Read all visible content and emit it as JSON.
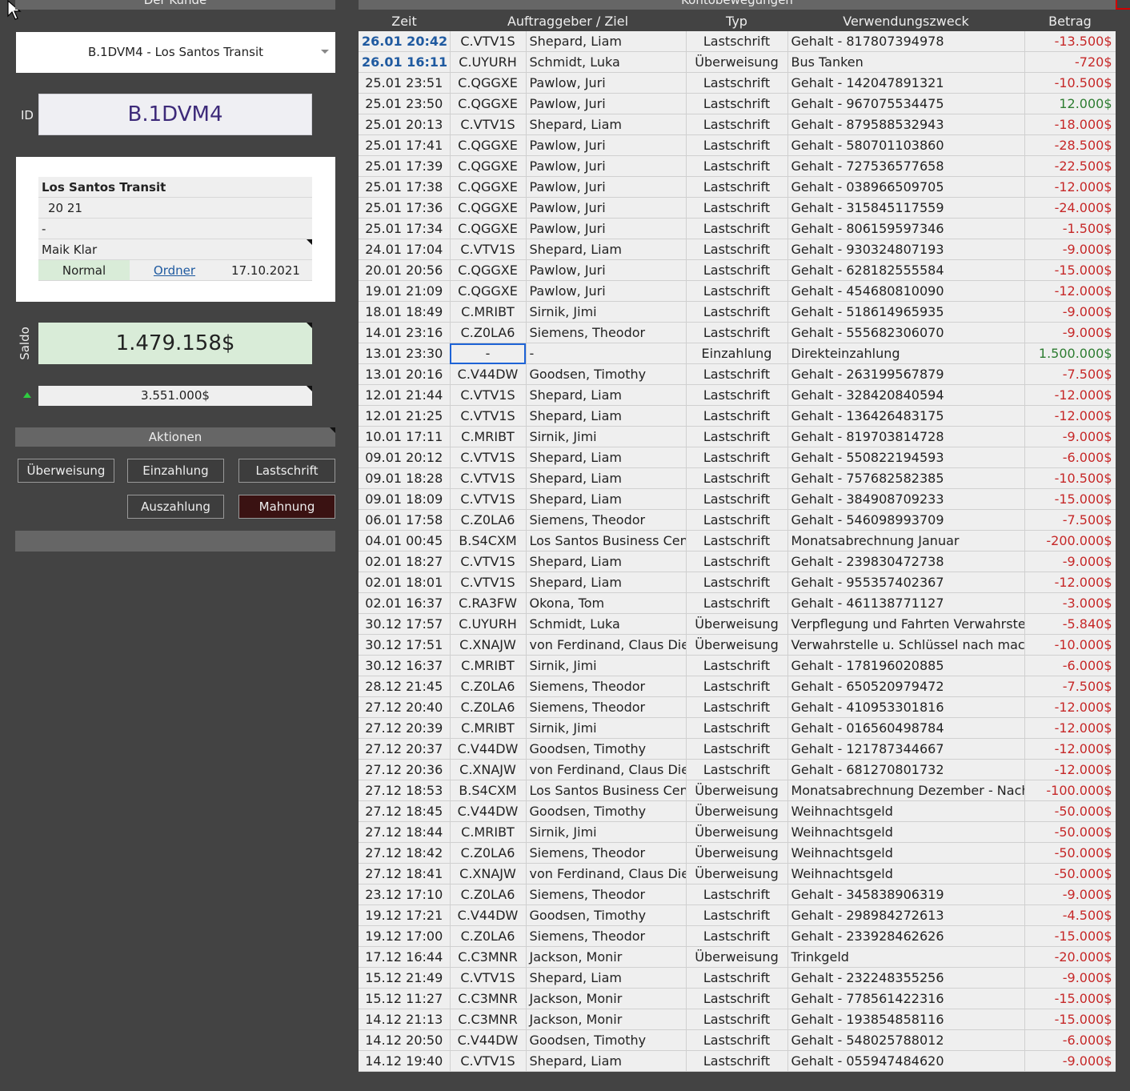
{
  "left": {
    "header": "Der Kunde",
    "customer_select": "B.1DVM4 - Los Santos Transit",
    "id_label": "ID",
    "id_value": "B.1DVM4",
    "info": {
      "name": "Los Santos Transit",
      "line2": "20 21",
      "line3": "-",
      "contact": "Maik Klar",
      "status": "Normal",
      "folder_link": "Ordner",
      "date": "17.10.2021"
    },
    "saldo_label": "Saldo",
    "saldo_value": "1.479.158$",
    "sub_value": "3.551.000$",
    "actions_header": "Aktionen",
    "buttons": {
      "ueberweisung": "Überweisung",
      "einzahlung": "Einzahlung",
      "lastschrift": "Lastschrift",
      "auszahlung": "Auszahlung",
      "mahnung": "Mahnung"
    }
  },
  "right": {
    "header": "Kontobewegungen",
    "columns": [
      "Zeit",
      "Auftraggeber / Ziel",
      "Typ",
      "Verwendungszweck",
      "Betrag"
    ],
    "rows": [
      [
        "26.01 20:42",
        "C.VTV1S",
        "Shepard, Liam",
        "Lastschrift",
        "Gehalt - 817807394978",
        "-13.500$"
      ],
      [
        "26.01 16:11",
        "C.UYURH",
        "Schmidt, Luka",
        "Überweisung",
        "Bus Tanken",
        "-720$"
      ],
      [
        "25.01 23:51",
        "C.QGGXE",
        "Pawlow, Juri",
        "Lastschrift",
        "Gehalt - 142047891321",
        "-10.500$"
      ],
      [
        "25.01 23:50",
        "C.QGGXE",
        "Pawlow, Juri",
        "Lastschrift",
        "Gehalt - 967075534475",
        "12.000$"
      ],
      [
        "25.01 20:13",
        "C.VTV1S",
        "Shepard, Liam",
        "Lastschrift",
        "Gehalt - 879588532943",
        "-18.000$"
      ],
      [
        "25.01 17:41",
        "C.QGGXE",
        "Pawlow, Juri",
        "Lastschrift",
        "Gehalt - 580701103860",
        "-28.500$"
      ],
      [
        "25.01 17:39",
        "C.QGGXE",
        "Pawlow, Juri",
        "Lastschrift",
        "Gehalt - 727536577658",
        "-22.500$"
      ],
      [
        "25.01 17:38",
        "C.QGGXE",
        "Pawlow, Juri",
        "Lastschrift",
        "Gehalt - 038966509705",
        "-12.000$"
      ],
      [
        "25.01 17:36",
        "C.QGGXE",
        "Pawlow, Juri",
        "Lastschrift",
        "Gehalt - 315845117559",
        "-24.000$"
      ],
      [
        "25.01 17:34",
        "C.QGGXE",
        "Pawlow, Juri",
        "Lastschrift",
        "Gehalt - 806159597346",
        "-1.500$"
      ],
      [
        "24.01 17:04",
        "C.VTV1S",
        "Shepard, Liam",
        "Lastschrift",
        "Gehalt - 930324807193",
        "-9.000$"
      ],
      [
        "20.01 20:56",
        "C.QGGXE",
        "Pawlow, Juri",
        "Lastschrift",
        "Gehalt - 628182555584",
        "-15.000$"
      ],
      [
        "19.01 21:09",
        "C.QGGXE",
        "Pawlow, Juri",
        "Lastschrift",
        "Gehalt - 454680810090",
        "-12.000$"
      ],
      [
        "18.01 18:49",
        "C.MRIBT",
        "Sirnik, Jimi",
        "Lastschrift",
        "Gehalt - 518614965935",
        "-9.000$"
      ],
      [
        "14.01 23:16",
        "C.Z0LA6",
        "Siemens, Theodor",
        "Lastschrift",
        "Gehalt - 555682306070",
        "-9.000$"
      ],
      [
        "13.01 23:30",
        "-",
        "-",
        "Einzahlung",
        "Direkteinzahlung",
        "1.500.000$"
      ],
      [
        "13.01 20:16",
        "C.V44DW",
        "Goodsen, Timothy",
        "Lastschrift",
        "Gehalt - 263199567879",
        "-7.500$"
      ],
      [
        "12.01 21:44",
        "C.VTV1S",
        "Shepard, Liam",
        "Lastschrift",
        "Gehalt - 328420840594",
        "-12.000$"
      ],
      [
        "12.01 21:25",
        "C.VTV1S",
        "Shepard, Liam",
        "Lastschrift",
        "Gehalt - 136426483175",
        "-12.000$"
      ],
      [
        "10.01 17:11",
        "C.MRIBT",
        "Sirnik, Jimi",
        "Lastschrift",
        "Gehalt - 819703814728",
        "-9.000$"
      ],
      [
        "09.01 20:12",
        "C.VTV1S",
        "Shepard, Liam",
        "Lastschrift",
        "Gehalt - 550822194593",
        "-6.000$"
      ],
      [
        "09.01 18:28",
        "C.VTV1S",
        "Shepard, Liam",
        "Lastschrift",
        "Gehalt - 757682582385",
        "-10.500$"
      ],
      [
        "09.01 18:09",
        "C.VTV1S",
        "Shepard, Liam",
        "Lastschrift",
        "Gehalt - 384908709233",
        "-15.000$"
      ],
      [
        "06.01 17:58",
        "C.Z0LA6",
        "Siemens, Theodor",
        "Lastschrift",
        "Gehalt - 546098993709",
        "-7.500$"
      ],
      [
        "04.01 00:45",
        "B.S4CXM",
        "Los Santos Business Cente",
        "Lastschrift",
        "Monatsabrechnung Januar",
        "-200.000$"
      ],
      [
        "02.01 18:27",
        "C.VTV1S",
        "Shepard, Liam",
        "Lastschrift",
        "Gehalt - 239830472738",
        "-9.000$"
      ],
      [
        "02.01 18:01",
        "C.VTV1S",
        "Shepard, Liam",
        "Lastschrift",
        "Gehalt - 955357402367",
        "-12.000$"
      ],
      [
        "02.01 16:37",
        "C.RA3FW",
        "Okona, Tom",
        "Lastschrift",
        "Gehalt - 461138771127",
        "-3.000$"
      ],
      [
        "30.12 17:57",
        "C.UYURH",
        "Schmidt, Luka",
        "Überweisung",
        "Verpflegung und Fahrten Verwahrstelle",
        "-5.840$"
      ],
      [
        "30.12 17:51",
        "C.XNAJW",
        "von Ferdinand, Claus Diete",
        "Überweisung",
        "Verwahrstelle u. Schlüssel nach macher",
        "-10.000$"
      ],
      [
        "30.12 16:37",
        "C.MRIBT",
        "Sirnik, Jimi",
        "Lastschrift",
        "Gehalt - 178196020885",
        "-6.000$"
      ],
      [
        "28.12 21:45",
        "C.Z0LA6",
        "Siemens, Theodor",
        "Lastschrift",
        "Gehalt - 650520979472",
        "-7.500$"
      ],
      [
        "27.12 20:40",
        "C.Z0LA6",
        "Siemens, Theodor",
        "Lastschrift",
        "Gehalt - 410953301816",
        "-12.000$"
      ],
      [
        "27.12 20:39",
        "C.MRIBT",
        "Sirnik, Jimi",
        "Lastschrift",
        "Gehalt - 016560498784",
        "-12.000$"
      ],
      [
        "27.12 20:37",
        "C.V44DW",
        "Goodsen, Timothy",
        "Lastschrift",
        "Gehalt - 121787344667",
        "-12.000$"
      ],
      [
        "27.12 20:36",
        "C.XNAJW",
        "von Ferdinand, Claus Diete",
        "Lastschrift",
        "Gehalt - 681270801732",
        "-12.000$"
      ],
      [
        "27.12 18:53",
        "B.S4CXM",
        "Los Santos Business Cente",
        "Überweisung",
        "Monatsabrechnung Dezember - Nachza",
        "-100.000$"
      ],
      [
        "27.12 18:45",
        "C.V44DW",
        "Goodsen, Timothy",
        "Überweisung",
        "Weihnachtsgeld",
        "-50.000$"
      ],
      [
        "27.12 18:44",
        "C.MRIBT",
        "Sirnik, Jimi",
        "Überweisung",
        "Weihnachtsgeld",
        "-50.000$"
      ],
      [
        "27.12 18:42",
        "C.Z0LA6",
        "Siemens, Theodor",
        "Überweisung",
        "Weihnachtsgeld",
        "-50.000$"
      ],
      [
        "27.12 18:41",
        "C.XNAJW",
        "von Ferdinand, Claus Diete",
        "Überweisung",
        "Weihnachtsgeld",
        "-50.000$"
      ],
      [
        "23.12 17:10",
        "C.Z0LA6",
        "Siemens, Theodor",
        "Lastschrift",
        "Gehalt - 345838906319",
        "-9.000$"
      ],
      [
        "19.12 17:21",
        "C.V44DW",
        "Goodsen, Timothy",
        "Lastschrift",
        "Gehalt - 298984272613",
        "-4.500$"
      ],
      [
        "19.12 17:00",
        "C.Z0LA6",
        "Siemens, Theodor",
        "Lastschrift",
        "Gehalt - 233928462626",
        "-15.000$"
      ],
      [
        "17.12 16:44",
        "C.C3MNR",
        "Jackson, Monir",
        "Überweisung",
        "Trinkgeld",
        "-20.000$"
      ],
      [
        "15.12 21:49",
        "C.VTV1S",
        "Shepard, Liam",
        "Lastschrift",
        "Gehalt - 232248355256",
        "-9.000$"
      ],
      [
        "15.12 11:27",
        "C.C3MNR",
        "Jackson, Monir",
        "Lastschrift",
        "Gehalt - 778561422316",
        "-15.000$"
      ],
      [
        "14.12 21:13",
        "C.C3MNR",
        "Jackson, Monir",
        "Lastschrift",
        "Gehalt - 193854858116",
        "-15.000$"
      ],
      [
        "14.12 20:50",
        "C.V44DW",
        "Goodsen, Timothy",
        "Lastschrift",
        "Gehalt - 548025788012",
        "-6.000$"
      ],
      [
        "14.12 19:40",
        "C.VTV1S",
        "Shepard, Liam",
        "Lastschrift",
        "Gehalt - 055947484620",
        "-9.000$"
      ]
    ]
  },
  "colors": {
    "negative": "#c62828",
    "positive": "#2e7d32",
    "panel": "#434343",
    "accent": "#1e63d6"
  }
}
